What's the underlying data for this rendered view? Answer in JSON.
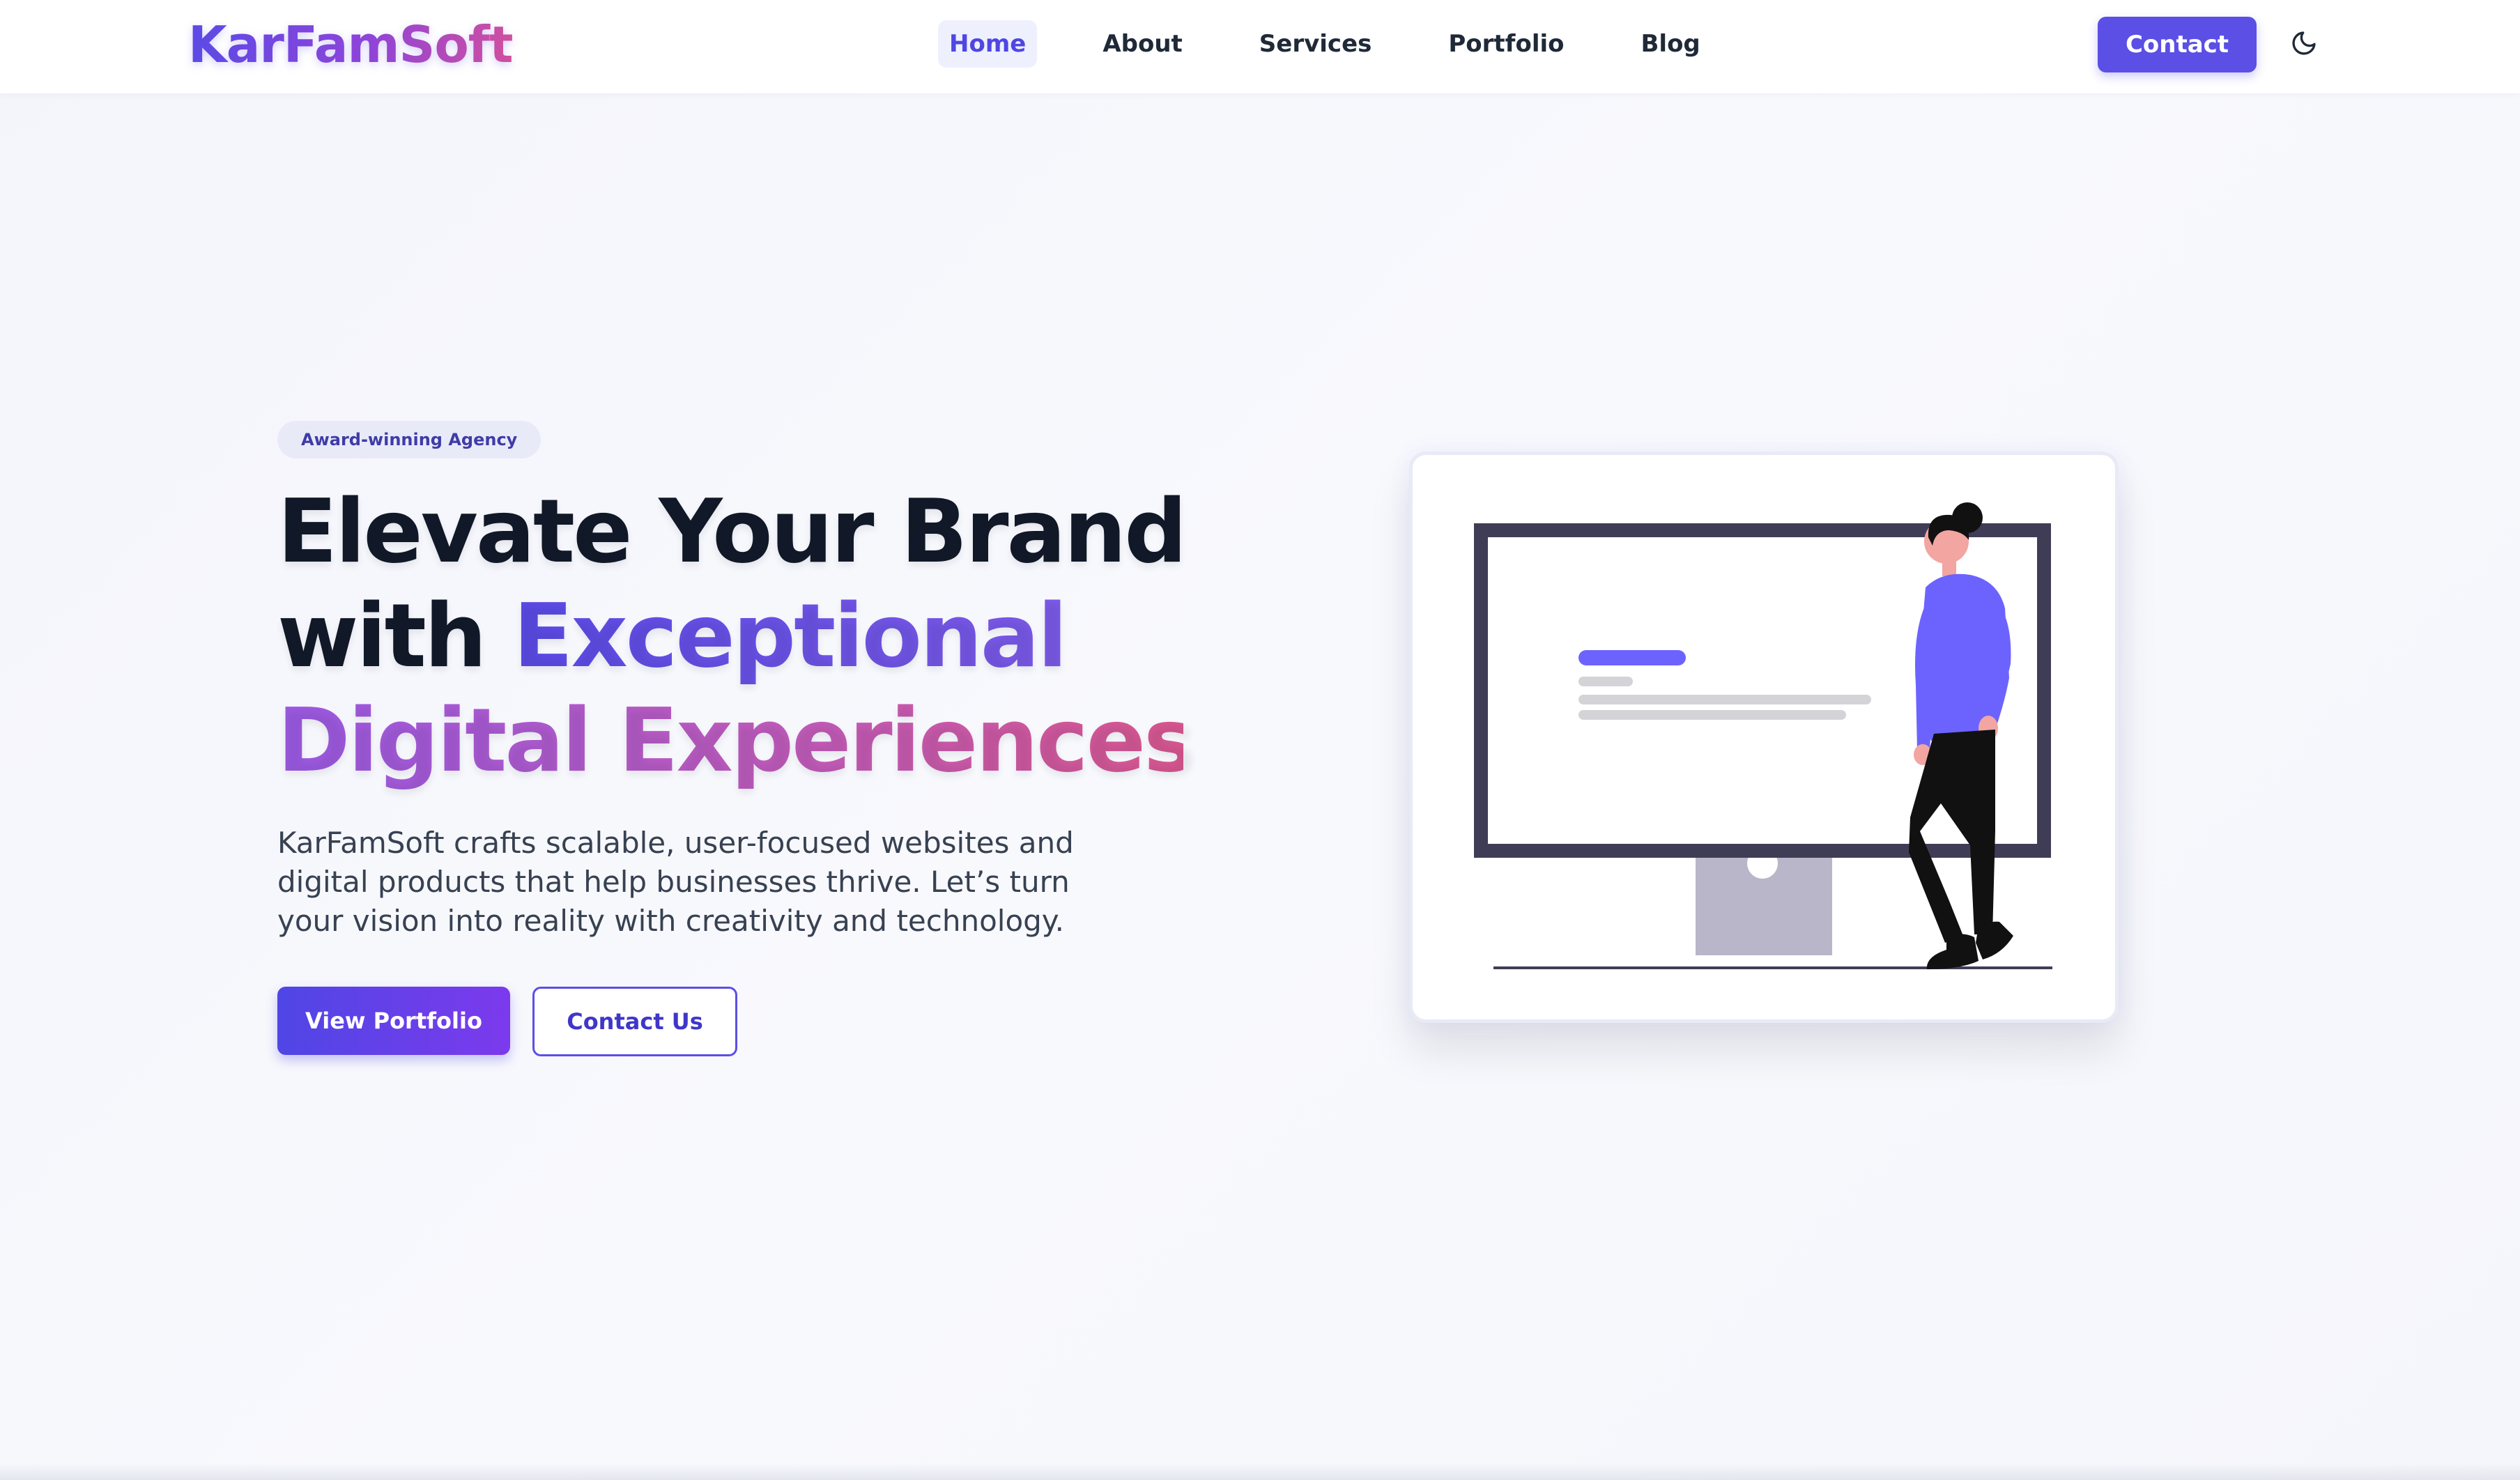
{
  "brand": {
    "name": "KarFamSoft"
  },
  "nav": {
    "items": [
      {
        "label": "Home",
        "active": true
      },
      {
        "label": "About",
        "active": false
      },
      {
        "label": "Services",
        "active": false
      },
      {
        "label": "Portfolio",
        "active": false
      },
      {
        "label": "Blog",
        "active": false
      }
    ],
    "contact_label": "Contact",
    "theme_toggle_icon": "moon-icon"
  },
  "hero": {
    "badge": "Award-winning Agency",
    "headline": {
      "part1": "Elevate Your Brand",
      "part2": "with ",
      "part3": "Exceptional",
      "part4": "Digital Experiences"
    },
    "description": "KarFamSoft crafts scalable, user-focused websites and digital products that help businesses thrive. Let’s turn your vision into reality with creativity and technology.",
    "primary_cta": "View Portfolio",
    "secondary_cta": "Contact Us",
    "illustration": "person-with-monitor-illustration"
  },
  "colors": {
    "accent": "#5b4fe6",
    "accent_purple": "#7c3aed",
    "accent_pink": "#d9578f",
    "text_dark": "#111827",
    "figure_blue": "#6c63ff"
  }
}
